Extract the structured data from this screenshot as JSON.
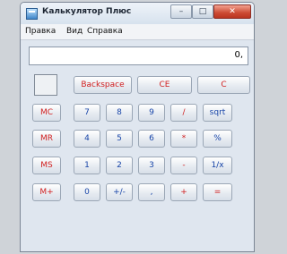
{
  "window": {
    "title": "Калькулятор Плюс"
  },
  "menu": [
    "Правка",
    "Вид",
    "Справка"
  ],
  "display": {
    "value": "0,"
  },
  "buttons": {
    "backspace": "Backspace",
    "ce": "CE",
    "c": "C",
    "mc": "MC",
    "mr": "MR",
    "ms": "MS",
    "mplus": "M+",
    "n7": "7",
    "n8": "8",
    "n9": "9",
    "div": "/",
    "sqrt": "sqrt",
    "n4": "4",
    "n5": "5",
    "n6": "6",
    "mul": "*",
    "pct": "%",
    "n1": "1",
    "n2": "2",
    "n3": "3",
    "sub": "-",
    "inv": "1/x",
    "n0": "0",
    "sign": "+/-",
    "dot": ",",
    "add": "+",
    "eq": "="
  },
  "colors": {
    "red_text": "#d11f1f",
    "blue_text": "#1845a8"
  }
}
